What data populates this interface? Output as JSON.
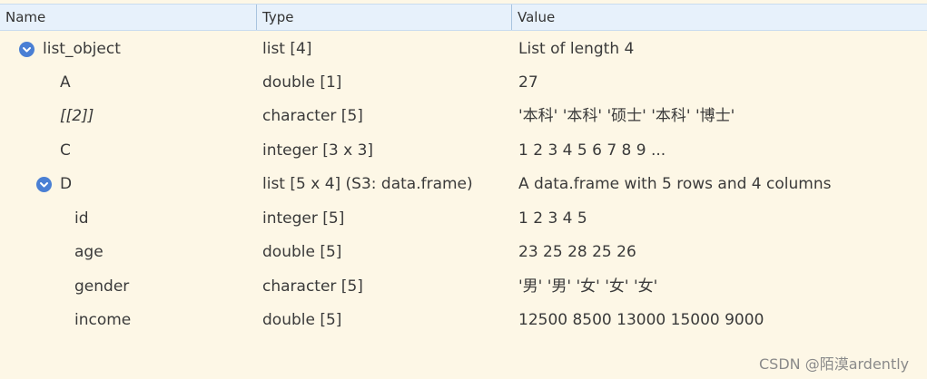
{
  "header": {
    "columns": [
      "Name",
      "Type",
      "Value"
    ]
  },
  "rows": [
    {
      "name": "list_object",
      "type": "list [4]",
      "value": "List of length 4",
      "expanded": true
    },
    {
      "name": "A",
      "type": "double [1]",
      "value": "27"
    },
    {
      "name": "[[2]]",
      "type": "character [5]",
      "value": "'本科' '本科' '硕士' '本科' '博士'"
    },
    {
      "name": "C",
      "type": "integer [3 x 3]",
      "value": "1 2 3 4 5 6 7 8 9 ..."
    },
    {
      "name": "D",
      "type": "list [5 x 4] (S3: data.frame)",
      "value": "A data.frame with 5 rows and 4 columns",
      "expanded": true
    },
    {
      "name": "id",
      "type": "integer [5]",
      "value": "1 2 3 4 5"
    },
    {
      "name": "age",
      "type": "double [5]",
      "value": "23 25 28 25 26"
    },
    {
      "name": "gender",
      "type": "character [5]",
      "value": "'男' '男' '女' '女' '女'"
    },
    {
      "name": "income",
      "type": "double [5]",
      "value": "12500 8500 13000 15000 9000"
    }
  ],
  "icons": {
    "expand_toggle": "chevron-down-circle-icon"
  },
  "colors": {
    "background": "#fdf7e6",
    "header_background": "#e7f1fb",
    "toggle": "#4a7fd4"
  },
  "watermark": "CSDN @陌漠ardently"
}
